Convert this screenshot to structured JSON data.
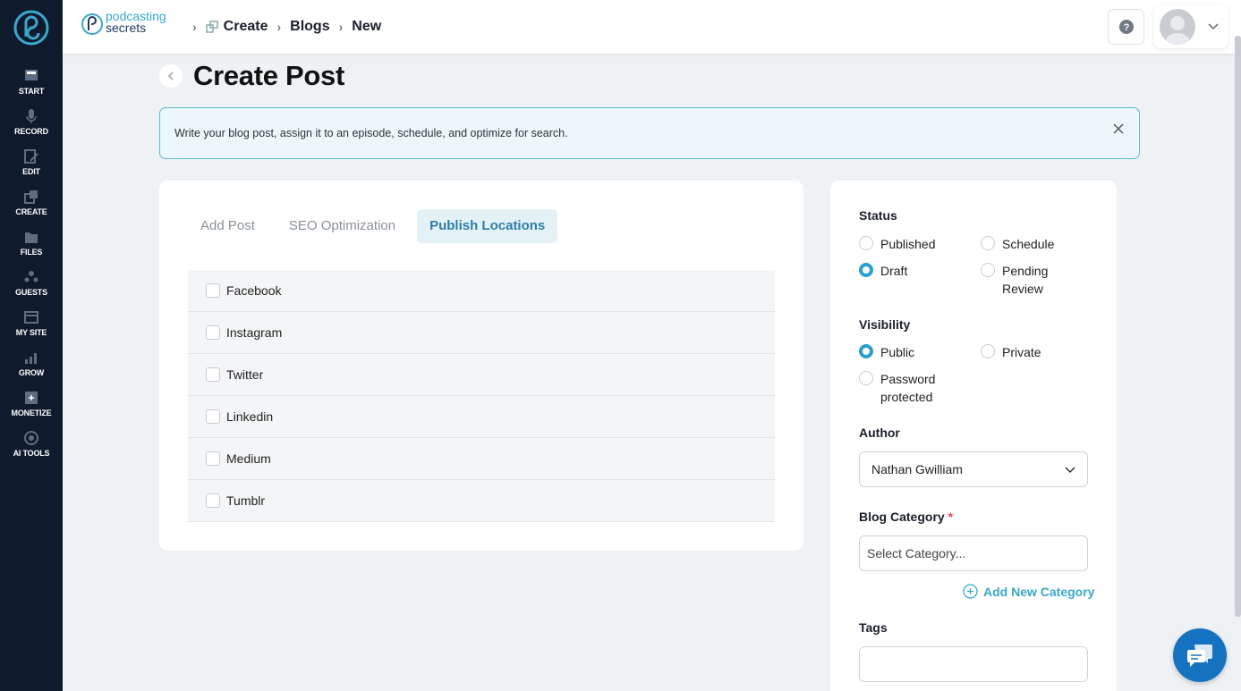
{
  "sidebar": {
    "items": [
      {
        "label": "START",
        "icon": "start-icon"
      },
      {
        "label": "RECORD",
        "icon": "microphone-icon"
      },
      {
        "label": "EDIT",
        "icon": "edit-icon"
      },
      {
        "label": "CREATE",
        "icon": "create-icon"
      },
      {
        "label": "FILES",
        "icon": "files-icon"
      },
      {
        "label": "GUESTS",
        "icon": "guests-icon"
      },
      {
        "label": "MY SITE",
        "icon": "my-site-icon"
      },
      {
        "label": "GROW",
        "icon": "grow-icon"
      },
      {
        "label": "MONETIZE",
        "icon": "monetize-icon"
      },
      {
        "label": "AI TOOLS",
        "icon": "ai-tools-icon"
      }
    ]
  },
  "header": {
    "brand_line1": "podcasting",
    "brand_line2": "secrets",
    "breadcrumbs": [
      "Create",
      "Blogs",
      "New"
    ]
  },
  "page": {
    "title": "Create Post",
    "alert": "Write your blog post, assign it to an episode, schedule, and optimize for search."
  },
  "tabs": [
    {
      "label": "Add Post",
      "active": false
    },
    {
      "label": "SEO Optimization",
      "active": false
    },
    {
      "label": "Publish Locations",
      "active": true
    }
  ],
  "publish_locations": [
    "Facebook",
    "Instagram",
    "Twitter",
    "Linkedin",
    "Medium",
    "Tumblr"
  ],
  "status": {
    "label": "Status",
    "options": [
      "Published",
      "Schedule",
      "Draft",
      "Pending Review"
    ],
    "selected": "Draft"
  },
  "visibility": {
    "label": "Visibility",
    "options": [
      "Public",
      "Private",
      "Password protected"
    ],
    "selected": "Public"
  },
  "author": {
    "label": "Author",
    "value": "Nathan Gwilliam"
  },
  "category": {
    "label": "Blog Category",
    "required_mark": "*",
    "placeholder": "Select Category...",
    "add_label": "Add New Category"
  },
  "tags": {
    "label": "Tags",
    "value": ""
  },
  "colors": {
    "accent": "#2b9fd1",
    "sidebar": "#0f1b2d",
    "link": "#3aa8c9"
  }
}
